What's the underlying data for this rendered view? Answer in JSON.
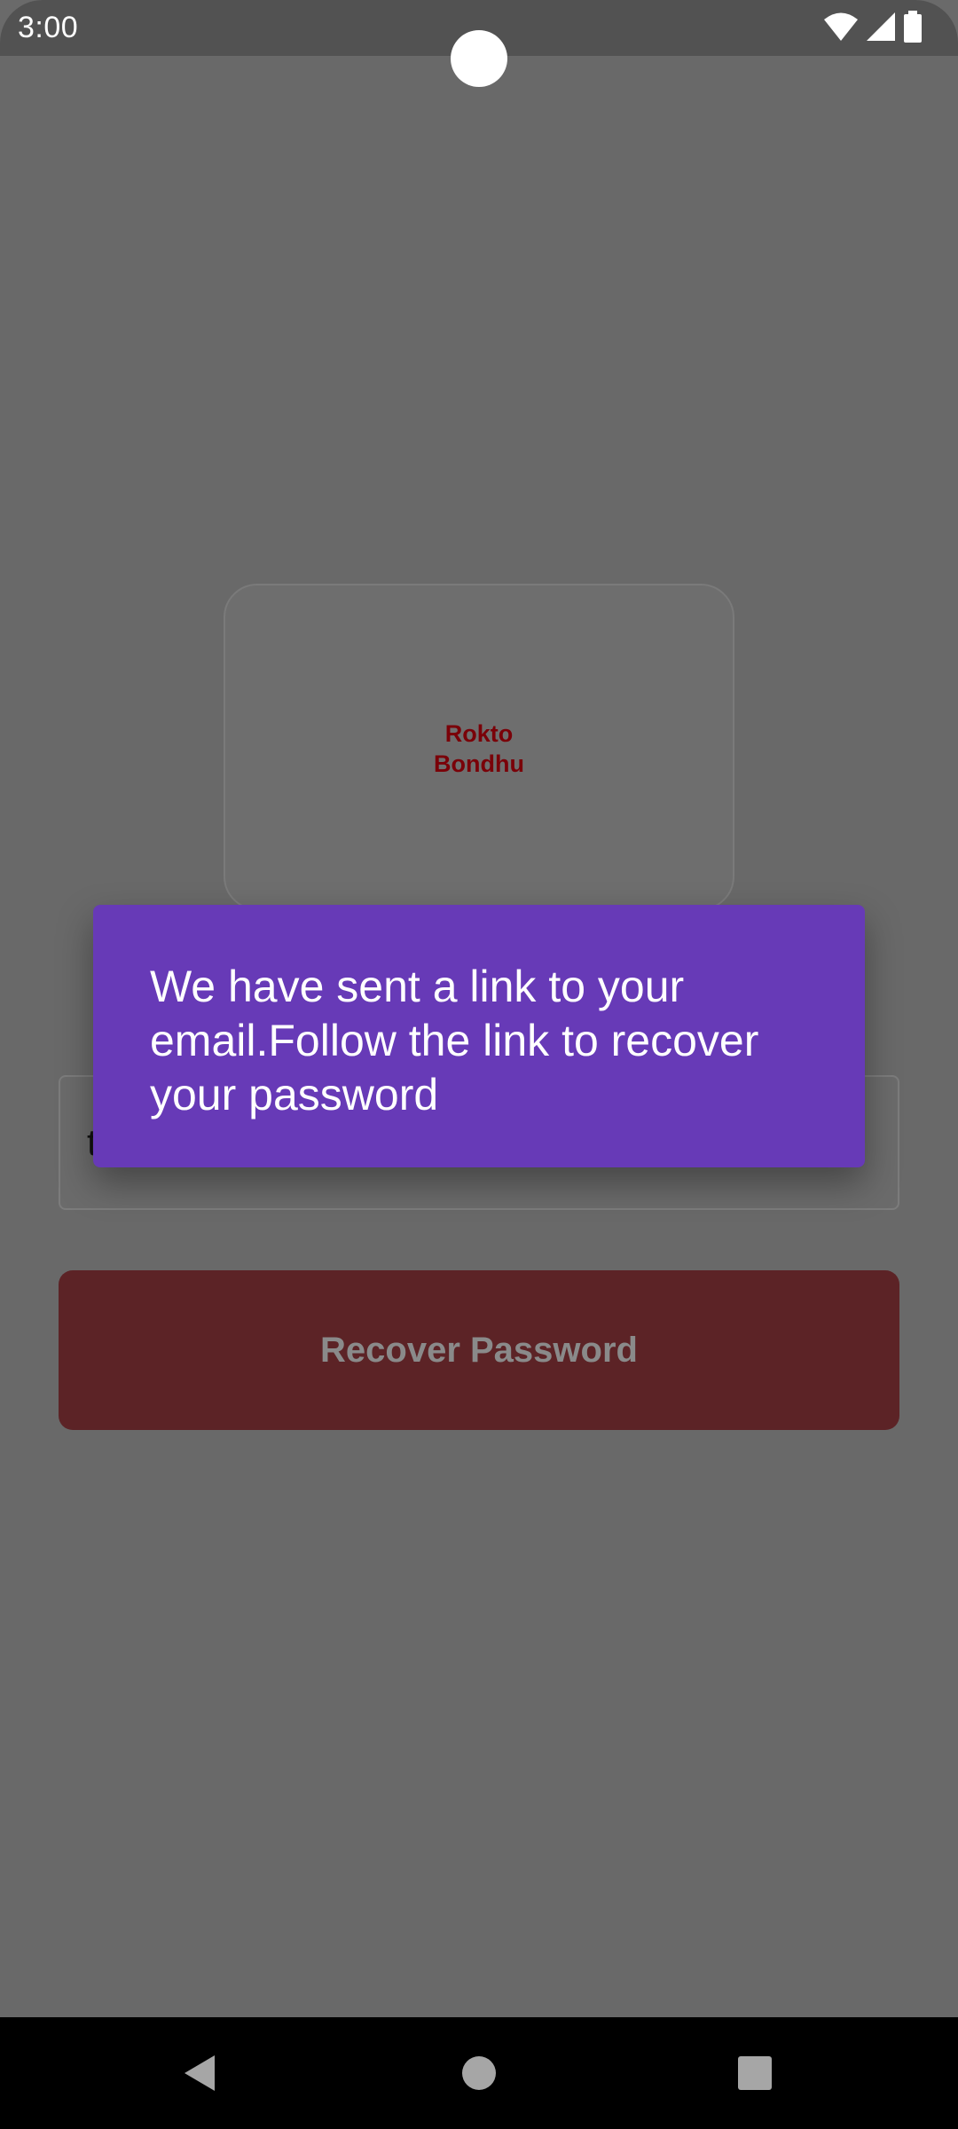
{
  "status_bar": {
    "time": "3:00",
    "icons": [
      "wifi-icon",
      "cellular-signal-icon",
      "battery-icon"
    ]
  },
  "logo": {
    "line1": "Rokto",
    "line2": "Bondhu"
  },
  "email_field": {
    "value": "t"
  },
  "recover_button": {
    "label": "Recover Password"
  },
  "toast": {
    "message": "We have sent a link to your email.Follow the link to recover your password"
  },
  "nav_bar": {
    "icons": [
      "back-icon",
      "home-icon",
      "recents-icon"
    ]
  },
  "colors": {
    "brand_red": "#7a0008",
    "button_bg": "#5c2326",
    "toast_bg": "#673ab7",
    "scrim": "#696969"
  }
}
